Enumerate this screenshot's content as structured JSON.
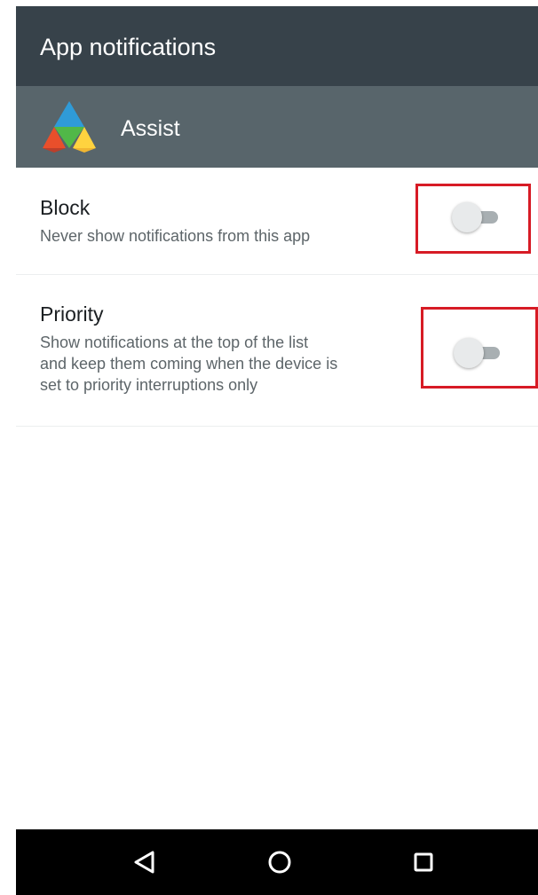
{
  "action_bar": {
    "title": "App notifications"
  },
  "app": {
    "name": "Assist",
    "icon": "multicolor-triangle-logo"
  },
  "settings": [
    {
      "title": "Block",
      "summary": "Never show notifications from this app",
      "enabled": false
    },
    {
      "title": "Priority",
      "summary": "Show notifications at the top of the list\nand keep them coming when the device is\nset to priority interruptions only",
      "enabled": false
    }
  ],
  "highlights": {
    "color": "#d71b25"
  },
  "navigation": {
    "back_icon": "triangle-back-icon",
    "home_icon": "circle-home-icon",
    "recent_icon": "square-overview-icon"
  },
  "colors": {
    "action_bar": "#37424a",
    "app_header": "#58656b",
    "nav_bar": "#000000",
    "toggle_track": "#a8afb2",
    "toggle_thumb": "#e8eaeb"
  }
}
